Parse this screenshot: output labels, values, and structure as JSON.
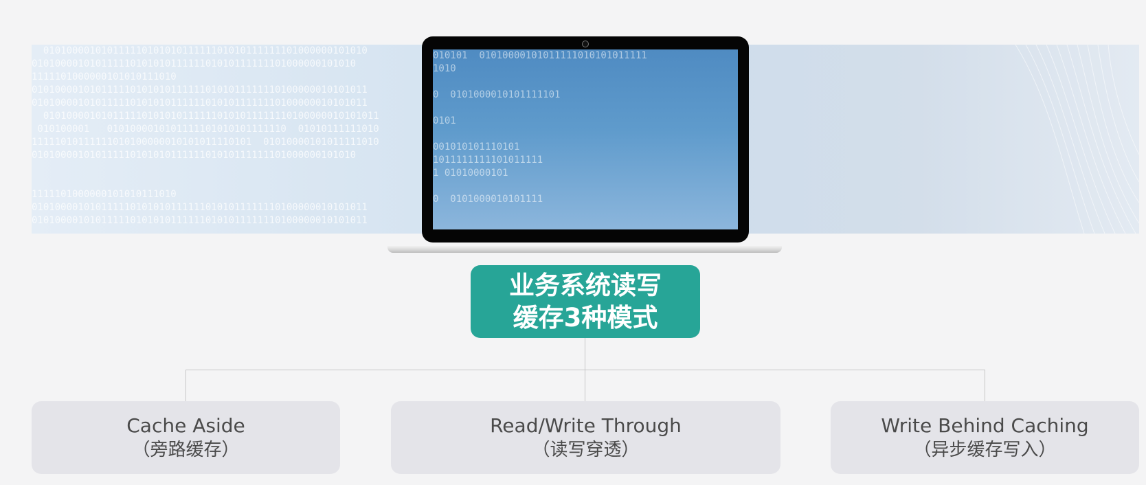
{
  "center": {
    "line1": "业务系统读写",
    "line2": "缓存3种模式"
  },
  "modes": [
    {
      "title": "Cache Aside",
      "subtitle": "（旁路缓存）"
    },
    {
      "title": "Read/Write Through",
      "subtitle": "（读写穿透）"
    },
    {
      "title": "Write Behind Caching",
      "subtitle": "（异步缓存写入）"
    }
  ],
  "colors": {
    "center_fill": "#27a597",
    "mode_fill": "#e4e4e9",
    "connector": "#c6c6c6",
    "background": "#f4f4f5"
  }
}
